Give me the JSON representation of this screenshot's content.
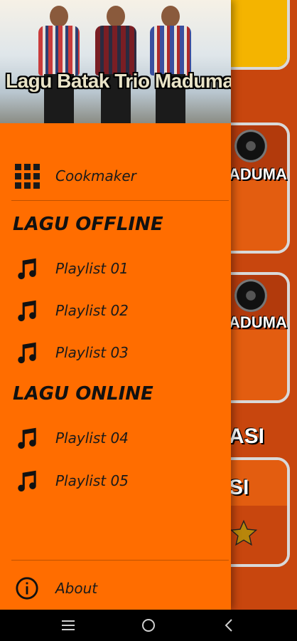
{
  "header": {
    "title": "Lagu Batak Trio Maduma"
  },
  "menu": {
    "cookmaker": {
      "label": "Cookmaker",
      "icon": "grid-icon"
    },
    "offline_section": "LAGU OFFLINE",
    "online_section": "LAGU ONLINE",
    "offline_items": [
      {
        "label": "Playlist 01",
        "icon": "music-note-icon"
      },
      {
        "label": "Playlist 02",
        "icon": "music-note-icon"
      },
      {
        "label": "Playlist 03",
        "icon": "music-note-icon"
      }
    ],
    "online_items": [
      {
        "label": "Playlist 04",
        "icon": "music-note-icon"
      },
      {
        "label": "Playlist 05",
        "icon": "music-note-icon"
      }
    ],
    "about": {
      "label": "About",
      "icon": "info-icon"
    }
  },
  "background": {
    "card_texts": [
      "ADUMA",
      "ADUMA",
      "ASI",
      "SI"
    ]
  },
  "navbar": {
    "buttons": [
      "menu-icon",
      "home-icon",
      "back-icon"
    ]
  },
  "colors": {
    "drawer": "#ff6d00",
    "text": "#1a1a1a",
    "navbar": "#000000"
  }
}
